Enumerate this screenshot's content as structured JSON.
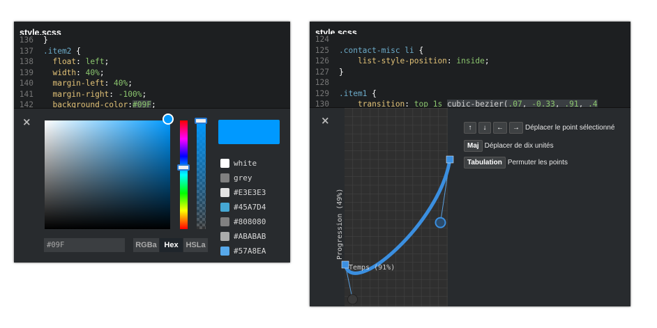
{
  "left": {
    "tab_title": "style.scss",
    "code_lines": [
      {
        "num": "136",
        "segments": [
          {
            "t": "}",
            "c": "w"
          }
        ]
      },
      {
        "num": "137",
        "segments": [
          {
            "t": ".item2 ",
            "c": "k"
          },
          {
            "t": "{",
            "c": "w"
          }
        ]
      },
      {
        "num": "138",
        "segments": [
          {
            "t": "  float",
            "c": "p"
          },
          {
            "t": ": ",
            "c": "w"
          },
          {
            "t": "left",
            "c": "v"
          },
          {
            "t": ";",
            "c": "w"
          }
        ]
      },
      {
        "num": "139",
        "segments": [
          {
            "t": "  width",
            "c": "p"
          },
          {
            "t": ": ",
            "c": "w"
          },
          {
            "t": "40%",
            "c": "v"
          },
          {
            "t": ";",
            "c": "w"
          }
        ]
      },
      {
        "num": "140",
        "segments": [
          {
            "t": "  margin-left",
            "c": "p"
          },
          {
            "t": ": ",
            "c": "w"
          },
          {
            "t": "40%",
            "c": "v"
          },
          {
            "t": ";",
            "c": "w"
          }
        ]
      },
      {
        "num": "141",
        "segments": [
          {
            "t": "  margin-right",
            "c": "p"
          },
          {
            "t": ": ",
            "c": "w"
          },
          {
            "t": "-100%",
            "c": "v"
          },
          {
            "t": ";",
            "c": "w"
          }
        ]
      },
      {
        "num": "142",
        "segments": [
          {
            "t": "  background-color",
            "c": "p"
          },
          {
            "t": ":",
            "c": "w"
          },
          {
            "t": "#09F",
            "c": "v sel"
          },
          {
            "t": ";",
            "c": "w"
          }
        ]
      }
    ],
    "picker": {
      "current_color": "#0099ff",
      "hex_value": "#09F",
      "formats": [
        "RGBa",
        "Hex",
        "HSLa"
      ],
      "active_format": "Hex",
      "swatches": [
        {
          "label": "white",
          "color": "#ffffff"
        },
        {
          "label": "grey",
          "color": "#808080"
        },
        {
          "label": "#E3E3E3",
          "color": "#E3E3E3"
        },
        {
          "label": "#45A7D4",
          "color": "#45A7D4"
        },
        {
          "label": "#808080",
          "color": "#808080"
        },
        {
          "label": "#ABABAB",
          "color": "#ABABAB"
        },
        {
          "label": "#57A8EA",
          "color": "#57A8EA"
        }
      ]
    }
  },
  "right": {
    "tab_title": "style.scss",
    "code_lines": [
      {
        "num": "124",
        "segments": [
          {
            "t": "",
            "c": "w"
          }
        ]
      },
      {
        "num": "125",
        "segments": [
          {
            "t": ".contact-misc li ",
            "c": "k"
          },
          {
            "t": "{",
            "c": "w"
          }
        ]
      },
      {
        "num": "126",
        "segments": [
          {
            "t": "    list-style-position",
            "c": "p"
          },
          {
            "t": ": ",
            "c": "w"
          },
          {
            "t": "inside",
            "c": "v"
          },
          {
            "t": ";",
            "c": "w"
          }
        ]
      },
      {
        "num": "127",
        "segments": [
          {
            "t": "}",
            "c": "w"
          }
        ]
      },
      {
        "num": "128",
        "segments": [
          {
            "t": "",
            "c": "w"
          }
        ]
      },
      {
        "num": "129",
        "segments": [
          {
            "t": ".item1 ",
            "c": "k"
          },
          {
            "t": "{",
            "c": "w"
          }
        ]
      },
      {
        "num": "130",
        "segments": [
          {
            "t": "    transition",
            "c": "p"
          },
          {
            "t": ": ",
            "c": "w"
          },
          {
            "t": "top ",
            "c": "v"
          },
          {
            "t": "1s ",
            "c": "v"
          },
          {
            "t": "cubic-bezier(",
            "c": "o sel"
          },
          {
            "t": ".07",
            "c": "v sel"
          },
          {
            "t": ", ",
            "c": "o sel"
          },
          {
            "t": "-0.33",
            "c": "v sel"
          },
          {
            "t": ", ",
            "c": "o sel"
          },
          {
            "t": ".91",
            "c": "v sel"
          },
          {
            "t": ", ",
            "c": "o sel"
          },
          {
            "t": ".4",
            "c": "v sel"
          }
        ]
      }
    ],
    "bezier": {
      "values": [
        0.07,
        -0.33,
        0.91,
        0.4
      ],
      "progress_label": "Progression (49%)",
      "time_label": "Temps (91%)",
      "hints": [
        {
          "keys": [
            "↑",
            "↓",
            "←",
            "→"
          ],
          "text": "Déplacer le point sélectionné"
        },
        {
          "keys": [
            "Maj"
          ],
          "text": "Déplacer de dix unités"
        },
        {
          "keys": [
            "Tabulation"
          ],
          "text": "Permuter les points"
        }
      ]
    }
  },
  "icons": {
    "close": "×"
  }
}
